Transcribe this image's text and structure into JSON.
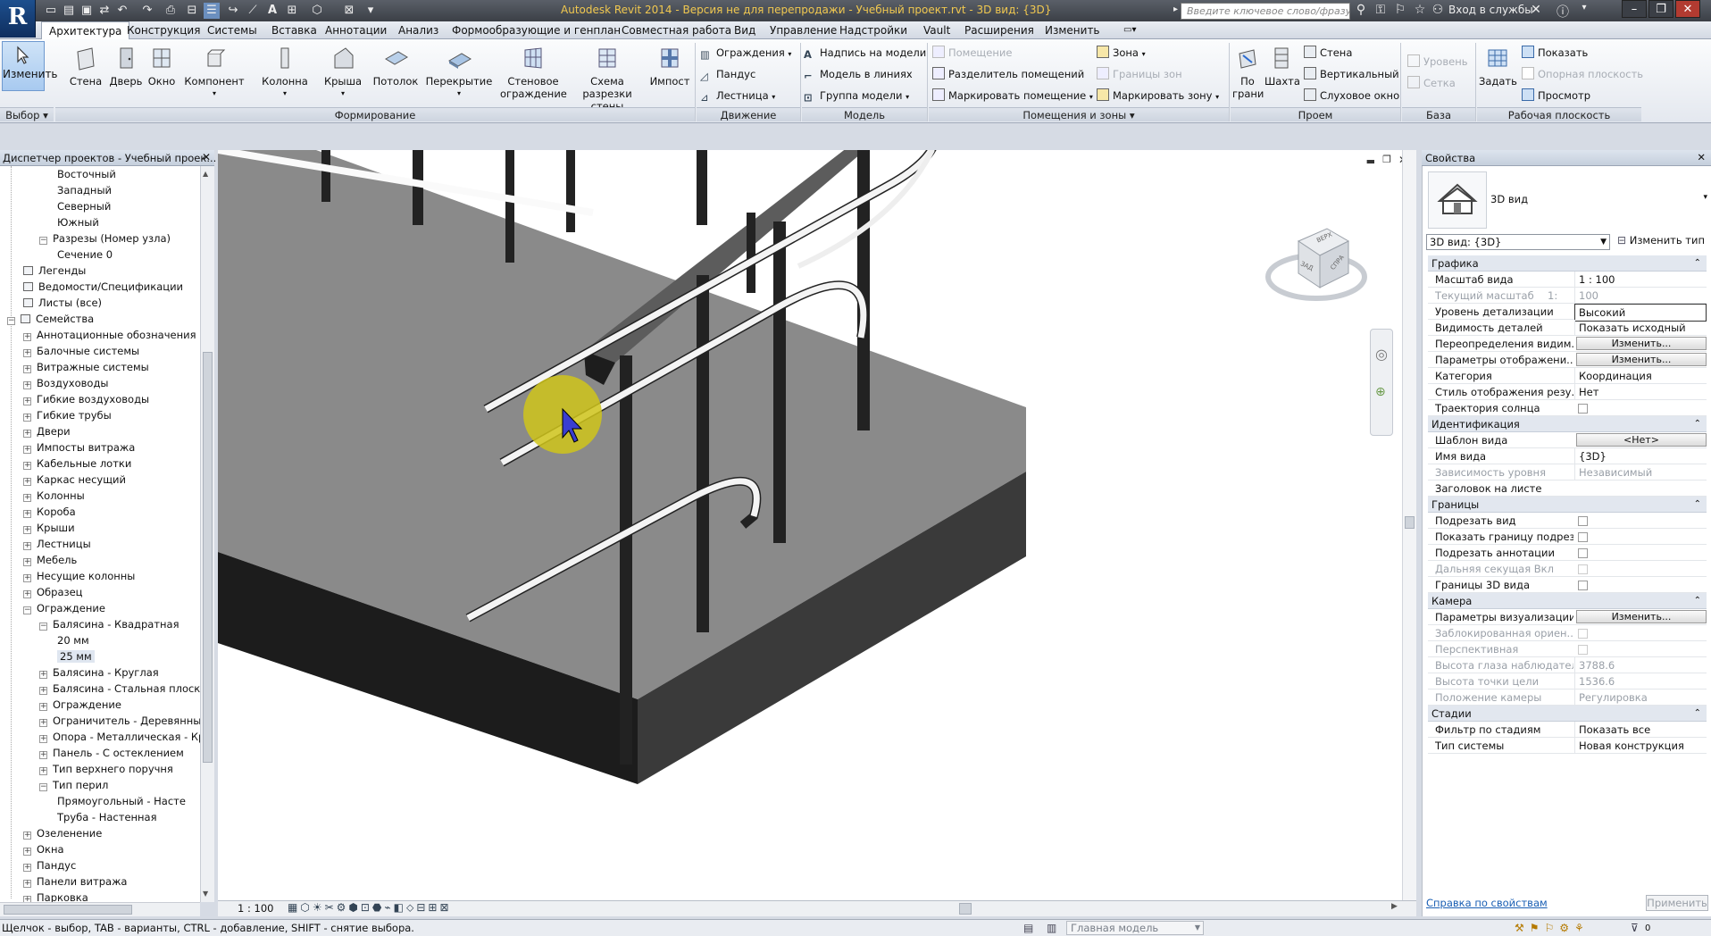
{
  "app": {
    "title": "Autodesk Revit 2014 - Версия не для перепродажи -   Учебный проект.rvt - 3D вид: {3D}",
    "search_placeholder": "Введите ключевое слово/фразу",
    "login": "Вход в службы"
  },
  "tabs": [
    "Архитектура",
    "Конструкция",
    "Системы",
    "Вставка",
    "Аннотации",
    "Анализ",
    "Формообразующие и генплан",
    "Совместная работа",
    "Вид",
    "Управление",
    "Надстройки",
    "Vault",
    "Расширения",
    "Изменить"
  ],
  "ribbon": {
    "modify": "Изменить",
    "select_label": "Выбор",
    "build": [
      "Стена",
      "Дверь",
      "Окно",
      "Компонент",
      "Колонна",
      "Крыша",
      "Потолок",
      "Перекрытие",
      "Стеновое ограждение",
      "Схема разрезки стены",
      "Импост"
    ],
    "build_label": "Формирование",
    "circulation": [
      "Ограждения",
      "Пандус",
      "Лестница"
    ],
    "circulation_label": "Движение",
    "model": [
      "Надпись на модели",
      "Модель в линиях",
      "Группа модели"
    ],
    "model_label": "Модель",
    "rooms": [
      "Помещение",
      "Разделитель помещений",
      "Маркировать помещение",
      "Зона",
      "Границы зон",
      "Маркировать зону"
    ],
    "rooms_label": "Помещения и зоны",
    "opening": [
      "По грани",
      "Шахта",
      "Стена",
      "Вертикальный",
      "Слуховое окно"
    ],
    "opening_label": "Проем",
    "datum": [
      "Уровень",
      "Сетка"
    ],
    "datum_label": "База",
    "workplane": [
      "Задать",
      "Показать",
      "Опорная плоскость",
      "Просмотр"
    ],
    "workplane_label": "Рабочая плоскость"
  },
  "browser": {
    "title": "Диспетчер проектов - Учебный проек...",
    "items": [
      {
        "label": "Восточный",
        "level": 3,
        "exp": ""
      },
      {
        "label": "Западный",
        "level": 3,
        "exp": ""
      },
      {
        "label": "Северный",
        "level": 3,
        "exp": ""
      },
      {
        "label": "Южный",
        "level": 3,
        "exp": ""
      },
      {
        "label": "Разрезы (Номер узла)",
        "level": 2,
        "exp": "−"
      },
      {
        "label": "Сечение 0",
        "level": 3,
        "exp": ""
      },
      {
        "label": "Легенды",
        "level": 1,
        "exp": "",
        "icon": true
      },
      {
        "label": "Ведомости/Спецификации",
        "level": 1,
        "exp": "",
        "icon": true
      },
      {
        "label": "Листы (все)",
        "level": 1,
        "exp": "",
        "icon": true
      },
      {
        "label": "Семейства",
        "level": 0,
        "exp": "−",
        "icon": true
      },
      {
        "label": "Аннотационные обозначения",
        "level": 1,
        "exp": "+"
      },
      {
        "label": "Балочные системы",
        "level": 1,
        "exp": "+"
      },
      {
        "label": "Витражные системы",
        "level": 1,
        "exp": "+"
      },
      {
        "label": "Воздуховоды",
        "level": 1,
        "exp": "+"
      },
      {
        "label": "Гибкие воздуховоды",
        "level": 1,
        "exp": "+"
      },
      {
        "label": "Гибкие трубы",
        "level": 1,
        "exp": "+"
      },
      {
        "label": "Двери",
        "level": 1,
        "exp": "+"
      },
      {
        "label": "Импосты витража",
        "level": 1,
        "exp": "+"
      },
      {
        "label": "Кабельные лотки",
        "level": 1,
        "exp": "+"
      },
      {
        "label": "Каркас несущий",
        "level": 1,
        "exp": "+"
      },
      {
        "label": "Колонны",
        "level": 1,
        "exp": "+"
      },
      {
        "label": "Короба",
        "level": 1,
        "exp": "+"
      },
      {
        "label": "Крыши",
        "level": 1,
        "exp": "+"
      },
      {
        "label": "Лестницы",
        "level": 1,
        "exp": "+"
      },
      {
        "label": "Мебель",
        "level": 1,
        "exp": "+"
      },
      {
        "label": "Несущие колонны",
        "level": 1,
        "exp": "+"
      },
      {
        "label": "Образец",
        "level": 1,
        "exp": "+"
      },
      {
        "label": "Ограждение",
        "level": 1,
        "exp": "−"
      },
      {
        "label": "Балясина - Квадратная",
        "level": 2,
        "exp": "−"
      },
      {
        "label": "20 мм",
        "level": 3,
        "exp": ""
      },
      {
        "label": "25 мм",
        "level": 3,
        "exp": "",
        "selected": true
      },
      {
        "label": "Балясина - Круглая",
        "level": 2,
        "exp": "+"
      },
      {
        "label": "Балясина - Стальная плоская",
        "level": 2,
        "exp": "+"
      },
      {
        "label": "Ограждение",
        "level": 2,
        "exp": "+"
      },
      {
        "label": "Ограничитель - Деревянный",
        "level": 2,
        "exp": "+"
      },
      {
        "label": "Опора - Металлическая - Кр",
        "level": 2,
        "exp": "+"
      },
      {
        "label": "Панель - С остеклением",
        "level": 2,
        "exp": "+"
      },
      {
        "label": "Тип верхнего поручня",
        "level": 2,
        "exp": "+"
      },
      {
        "label": "Тип перил",
        "level": 2,
        "exp": "−"
      },
      {
        "label": "Прямоугольный - Насте",
        "level": 3,
        "exp": ""
      },
      {
        "label": "Труба - Настенная",
        "level": 3,
        "exp": ""
      },
      {
        "label": "Озеленение",
        "level": 1,
        "exp": "+"
      },
      {
        "label": "Окна",
        "level": 1,
        "exp": "+"
      },
      {
        "label": "Пандус",
        "level": 1,
        "exp": "+"
      },
      {
        "label": "Панели витража",
        "level": 1,
        "exp": "+"
      },
      {
        "label": "Парковка",
        "level": 1,
        "exp": "+"
      }
    ]
  },
  "viewport": {
    "scale": "1 : 100",
    "viewcube": [
      "ВЕРХ",
      "ЗАД",
      "СПРА"
    ]
  },
  "properties": {
    "title": "Свойства",
    "type_name": "3D вид",
    "selector": "3D вид: {3D}",
    "edit_type": "Изменить тип",
    "rows": [
      {
        "group": "Графика"
      },
      {
        "k": "Масштаб вида",
        "v": "1 : 100"
      },
      {
        "k": "Текущий масштаб",
        "v": "100",
        "grey": true,
        "extra": "1:"
      },
      {
        "k": "Уровень детализации",
        "v": "Высокий",
        "boxed": true
      },
      {
        "k": "Видимость деталей",
        "v": "Показать исходный"
      },
      {
        "k": "Переопределения видим...",
        "btn": "Изменить..."
      },
      {
        "k": "Параметры отображени...",
        "btn": "Изменить..."
      },
      {
        "k": "Категория",
        "v": "Координация"
      },
      {
        "k": "Стиль отображения резу...",
        "v": "Нет"
      },
      {
        "k": "Траектория солнца",
        "chk": true
      },
      {
        "group": "Идентификация"
      },
      {
        "k": "Шаблон вида",
        "btn": "<Нет>"
      },
      {
        "k": "Имя вида",
        "v": "{3D}"
      },
      {
        "k": "Зависимость уровня",
        "v": "Независимый",
        "grey": true
      },
      {
        "k": "Заголовок на листе",
        "v": ""
      },
      {
        "group": "Границы"
      },
      {
        "k": "Подрезать вид",
        "chk": true
      },
      {
        "k": "Показать границу подрез...",
        "chk": true
      },
      {
        "k": "Подрезать аннотации",
        "chk": true
      },
      {
        "k": "Дальняя секущая Вкл",
        "chk": true,
        "grey": true
      },
      {
        "k": "Границы 3D вида",
        "chk": true
      },
      {
        "group": "Камера"
      },
      {
        "k": "Параметры визуализации",
        "btn": "Изменить..."
      },
      {
        "k": "Заблокированная ориен...",
        "chk": true,
        "grey": true
      },
      {
        "k": "Перспективная",
        "chk": true,
        "grey": true
      },
      {
        "k": "Высота глаза наблюдателя",
        "v": "3788.6",
        "grey": true
      },
      {
        "k": "Высота точки цели",
        "v": "1536.6",
        "grey": true
      },
      {
        "k": "Положение камеры",
        "v": "Регулировка",
        "grey": true
      },
      {
        "group": "Стадии"
      },
      {
        "k": "Фильтр по стадиям",
        "v": "Показать все"
      },
      {
        "k": "Тип системы",
        "v": "Новая конструкция"
      }
    ],
    "help_link": "Справка по свойствам",
    "apply": "Применить"
  },
  "status": {
    "hint": "Щелчок - выбор, TAB - варианты, CTRL - добавление, SHIFT - снятие выбора.",
    "model": "Главная модель",
    "filter_count": "0"
  }
}
